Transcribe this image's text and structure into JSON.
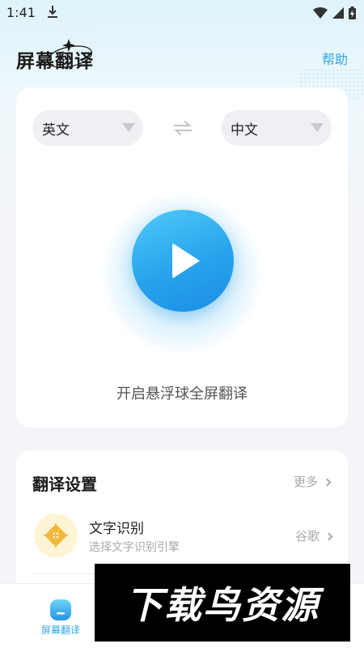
{
  "status_bar": {
    "time": "1:41"
  },
  "header": {
    "title": "屏幕翻译",
    "help_label": "帮助"
  },
  "languages": {
    "source": "英文",
    "target": "中文"
  },
  "main": {
    "caption": "开启悬浮球全屏翻译"
  },
  "settings": {
    "title": "翻译设置",
    "more_label": "更多",
    "rows": [
      {
        "label": "文字识别",
        "subtitle": "选择文字识别引擎",
        "value": "谷歌"
      }
    ]
  },
  "bottom_nav": {
    "items": [
      {
        "label": "屏幕翻译",
        "active": true
      }
    ]
  },
  "watermark": {
    "text": "下载鸟资源"
  },
  "colors": {
    "accent": "#2fa8e8",
    "play_button": "#27a3ec",
    "icon_gold": "#f2b83a"
  }
}
